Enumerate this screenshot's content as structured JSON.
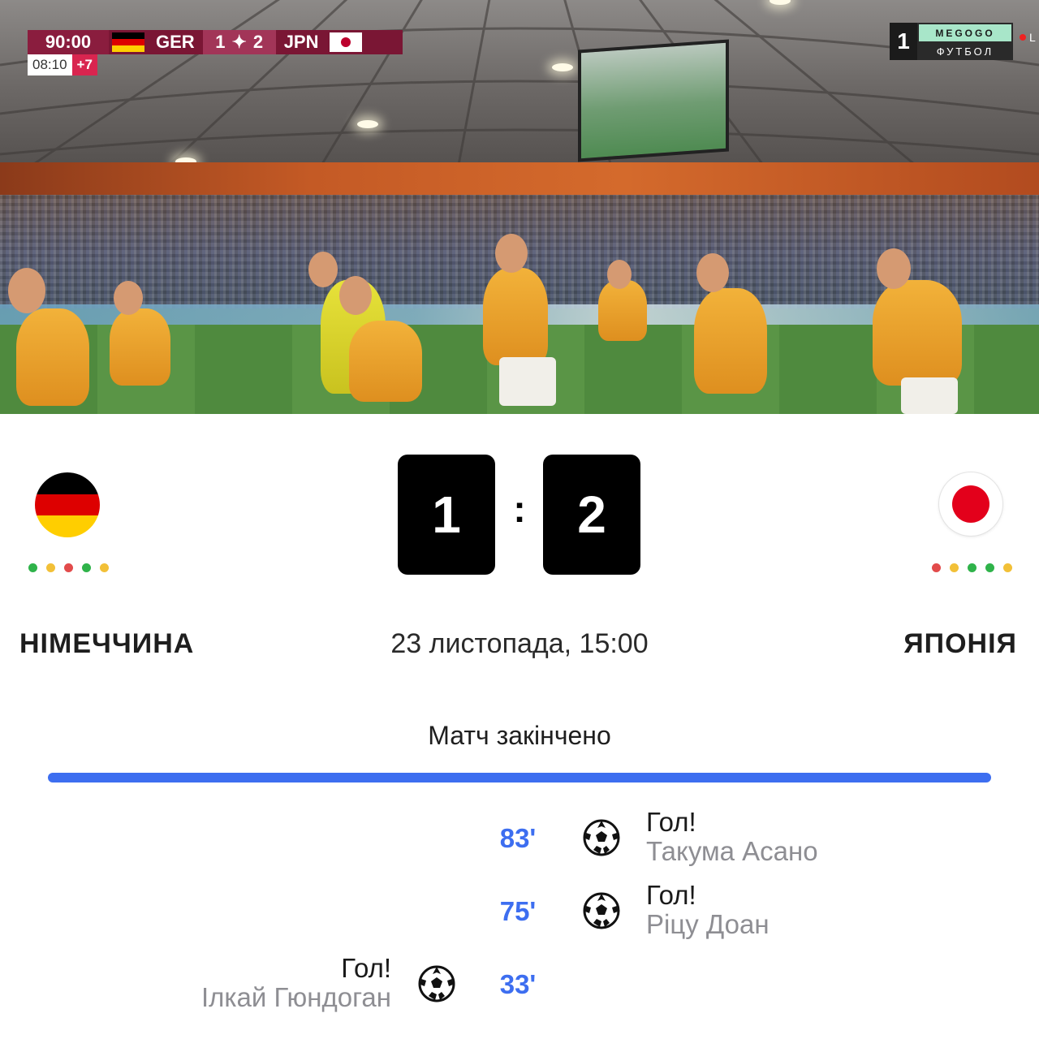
{
  "broadcast": {
    "scorebug": {
      "time": "90:00",
      "home_code": "GER",
      "home_score": "1",
      "away_score": "2",
      "away_code": "JPN",
      "clock": "08:10",
      "added_time": "+7"
    },
    "channel": {
      "number": "1",
      "brand": "MEGOGO",
      "name": "ФУТБОЛ",
      "live_letter": "L"
    }
  },
  "match": {
    "home": {
      "name": "НІМЕЧЧИНА",
      "score": "1",
      "flag": "germany-flag",
      "form": [
        "#2fb34a",
        "#f2c037",
        "#e24b4b",
        "#2fb34a",
        "#f2c037"
      ]
    },
    "away": {
      "name": "ЯПОНІЯ",
      "score": "2",
      "flag": "japan-flag",
      "form": [
        "#e24b4b",
        "#f2c037",
        "#2fb34a",
        "#2fb34a",
        "#f2c037"
      ]
    },
    "separator": ":",
    "date": "23 листопада, 15:00",
    "status": "Матч закінчено",
    "progress": 1.0
  },
  "colors": {
    "accent": "#3d6ef0",
    "win": "#2fb34a",
    "draw": "#f2c037",
    "loss": "#e24b4b"
  },
  "events": [
    {
      "minute": "83'",
      "side": "away",
      "type": "Гол!",
      "player": "Такума Асано",
      "icon": "soccer-ball-icon"
    },
    {
      "minute": "75'",
      "side": "away",
      "type": "Гол!",
      "player": "Ріцу Доан",
      "icon": "soccer-ball-icon"
    },
    {
      "minute": "33'",
      "side": "home",
      "type": "Гол!",
      "player": "Ілкай Гюндоган",
      "icon": "soccer-ball-icon"
    }
  ]
}
